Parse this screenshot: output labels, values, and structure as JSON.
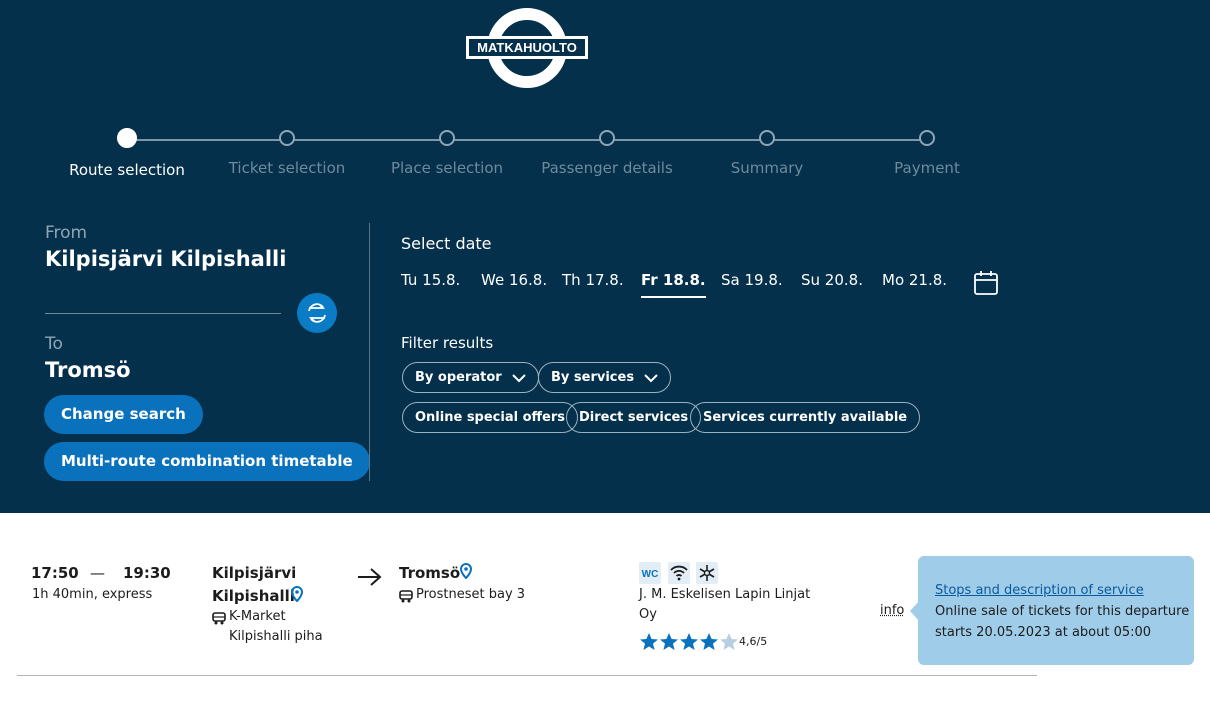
{
  "brand": {
    "name": "MATKAHUOLTO"
  },
  "steps": [
    {
      "label": "Route selection",
      "active": true
    },
    {
      "label": "Ticket selection",
      "active": false
    },
    {
      "label": "Place selection",
      "active": false
    },
    {
      "label": "Passenger details",
      "active": false
    },
    {
      "label": "Summary",
      "active": false
    },
    {
      "label": "Payment",
      "active": false
    }
  ],
  "search": {
    "from_label": "From",
    "from_value": "Kilpisjärvi Kilpishalli",
    "to_label": "To",
    "to_value": "Tromsö",
    "swap_icon": "swap-arrows-icon",
    "change_search": "Change search",
    "multi_route": "Multi-route combination timetable"
  },
  "dates": {
    "title": "Select date",
    "items": [
      "Tu 15.8.",
      "We 16.8.",
      "Th 17.8.",
      "Fr 18.8.",
      "Sa 19.8.",
      "Su 20.8.",
      "Mo 21.8."
    ],
    "selected_index": 3,
    "calendar_icon": "calendar-icon"
  },
  "filters": {
    "title": "Filter results",
    "dropdowns": [
      "By operator",
      "By services"
    ],
    "toggles": [
      "Online special offers",
      "Direct services",
      "Services currently available"
    ]
  },
  "result": {
    "depart_time": "17:50",
    "dash": "—",
    "arrive_time": "19:30",
    "duration": "1h 40min, express",
    "origin_line1": "Kilpisjärvi",
    "origin_line2": "Kilpishalli",
    "origin_stop_line1": "K-Market",
    "origin_stop_line2": "Kilpishalli piha",
    "destination": "Tromsö",
    "destination_stop": "Prostneset bay 3",
    "services": [
      "wc-icon",
      "wifi-icon",
      "air-conditioning-icon"
    ],
    "wc_text": "WC",
    "operator_line1": "J. M. Eskelisen Lapin Linjat",
    "operator_line2": "Oy",
    "rating": 4.6,
    "rating_text": "4,6/5",
    "info_link": "info",
    "popup_link": "Stops and description of service",
    "popup_text_line1": "Online sale of tickets for this departure",
    "popup_text_line2": "starts 20.05.2023 at about 05:00"
  },
  "colors": {
    "header_bg": "#04304b",
    "accent_blue": "#0a72bd",
    "popup_bg": "#9fcde9",
    "star": "#0a72bd"
  }
}
